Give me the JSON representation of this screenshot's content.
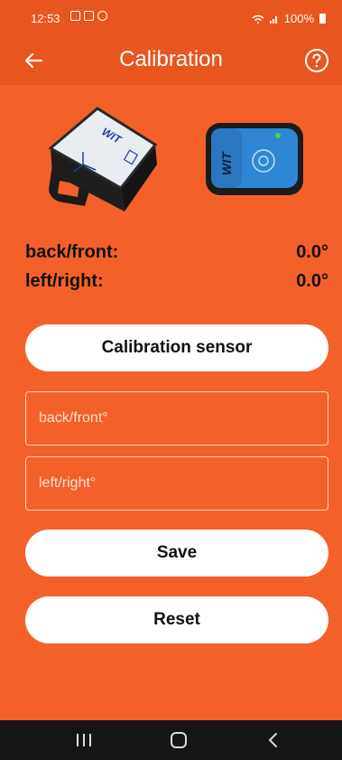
{
  "status_bar": {
    "time": "12:53",
    "battery": "100%",
    "icons": [
      "gallery-icon",
      "facebook-icon",
      "notification-icon",
      "wifi-icon",
      "signal-icon",
      "battery-icon"
    ]
  },
  "app_bar": {
    "title": "Calibration",
    "back_icon": "arrow-left-icon",
    "help_icon": "help-circle-icon"
  },
  "readings": [
    {
      "label": "back/front:",
      "value": "0.0°"
    },
    {
      "label": "left/right:",
      "value": "0.0°"
    }
  ],
  "buttons": {
    "calibrate": "Calibration sensor",
    "save": "Save",
    "reset": "Reset"
  },
  "fields": {
    "back_front_placeholder": "back/front°",
    "left_right_placeholder": "left/right°"
  },
  "sensor_labels": {
    "left_brand": "WIT",
    "right_brand": "WIT"
  },
  "colors": {
    "background": "#f4602a",
    "bar": "#e8551f",
    "button": "#ffffff",
    "nav": "#151515"
  }
}
